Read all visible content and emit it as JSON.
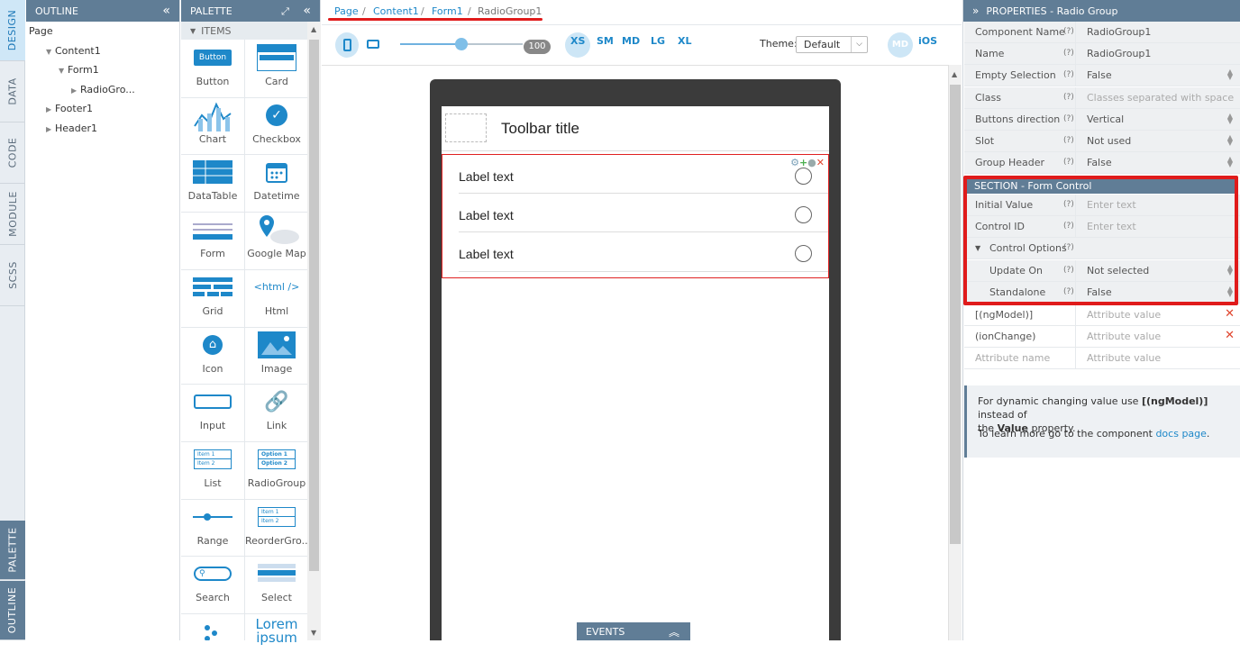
{
  "vertical_tabs": {
    "design": "DESIGN",
    "data": "DATA",
    "code": "CODE",
    "module": "MODULE",
    "scss": "SCSS",
    "palette": "PALETTE",
    "outline": "OUTLINE"
  },
  "outline": {
    "title": "OUTLINE",
    "collapse_icon": "«",
    "items": [
      "Page",
      "Content1",
      "Form1",
      "RadioGro...",
      "Footer1",
      "Header1"
    ]
  },
  "palette": {
    "title": "PALETTE",
    "section": "ITEMS",
    "items": [
      "Button",
      "Card",
      "Chart",
      "Checkbox",
      "DataTable",
      "Datetime",
      "Form",
      "Google Map",
      "Grid",
      "Html",
      "Icon",
      "Image",
      "Input",
      "Link",
      "List",
      "RadioGroup",
      "Range",
      "ReorderGro...",
      "Search",
      "Select",
      "",
      "Lorem ipsum"
    ],
    "button_icon_label": "Button",
    "html_icon_label": "<html />",
    "lorem_label": "Lorem ipsum",
    "list_icon": [
      "Item 1",
      "Item 2"
    ],
    "radio_icon": [
      "Option 1",
      "Option 2"
    ],
    "reorder_icon": [
      "Item 1",
      "Item 2"
    ]
  },
  "breadcrumb": [
    "Page",
    "Content1",
    "Form1",
    "RadioGroup1"
  ],
  "breadcrumb_sep": "/",
  "toolbar": {
    "zoom_value": "100",
    "zoom_fraction": 0.5,
    "sizes": [
      "XS",
      "SM",
      "MD",
      "LG",
      "XL"
    ],
    "theme_label": "Theme:",
    "theme_value": "Default",
    "md_badge": "MD",
    "ios_label": "iOS"
  },
  "device": {
    "toolbar_title": "Toolbar title",
    "radio_labels": [
      "Label text",
      "Label text",
      "Label text"
    ]
  },
  "events_label": "EVENTS",
  "properties": {
    "title": "PROPERTIES - Radio Group",
    "rows": [
      {
        "key": "Component Name",
        "value": "RadioGroup1"
      },
      {
        "key": "Name",
        "value": "RadioGroup1"
      },
      {
        "key": "Empty Selection",
        "value": "False"
      },
      {
        "key": "Class",
        "placeholder": "Classes separated with space"
      },
      {
        "key": "Buttons direction",
        "value": "Vertical"
      },
      {
        "key": "Slot",
        "value": "Not used"
      },
      {
        "key": "Group Header",
        "value": "False"
      }
    ],
    "section_title": "SECTION - Form Control",
    "section_rows": [
      {
        "key": "Initial Value",
        "placeholder": "Enter text"
      },
      {
        "key": "Control ID",
        "placeholder": "Enter text"
      }
    ],
    "control_options": "Control Options",
    "option_rows": [
      {
        "key": "Update On",
        "value": "Not selected"
      },
      {
        "key": "Standalone",
        "value": "False"
      }
    ],
    "attr_rows": [
      {
        "key": "[(ngModel)]",
        "placeholder": "Attribute value"
      },
      {
        "key": "(ionChange)",
        "placeholder": "Attribute value"
      }
    ],
    "attr_name_placeholder": "Attribute name",
    "attr_value_placeholder": "Attribute value",
    "q": "(?)",
    "info_line1_a": "For dynamic changing value use ",
    "info_line1_b": "[(ngModel)]",
    "info_line1_c": " instead of",
    "info_line2_a": "the ",
    "info_line2_b": "Value",
    "info_line2_c": " property.",
    "info_line3_a": "To learn more go to the component ",
    "info_link": "docs page",
    "info_line3_c": "."
  },
  "colors": {
    "accent": "#1e88c9",
    "header": "#607d96",
    "highlight_red": "#e01b1b"
  }
}
